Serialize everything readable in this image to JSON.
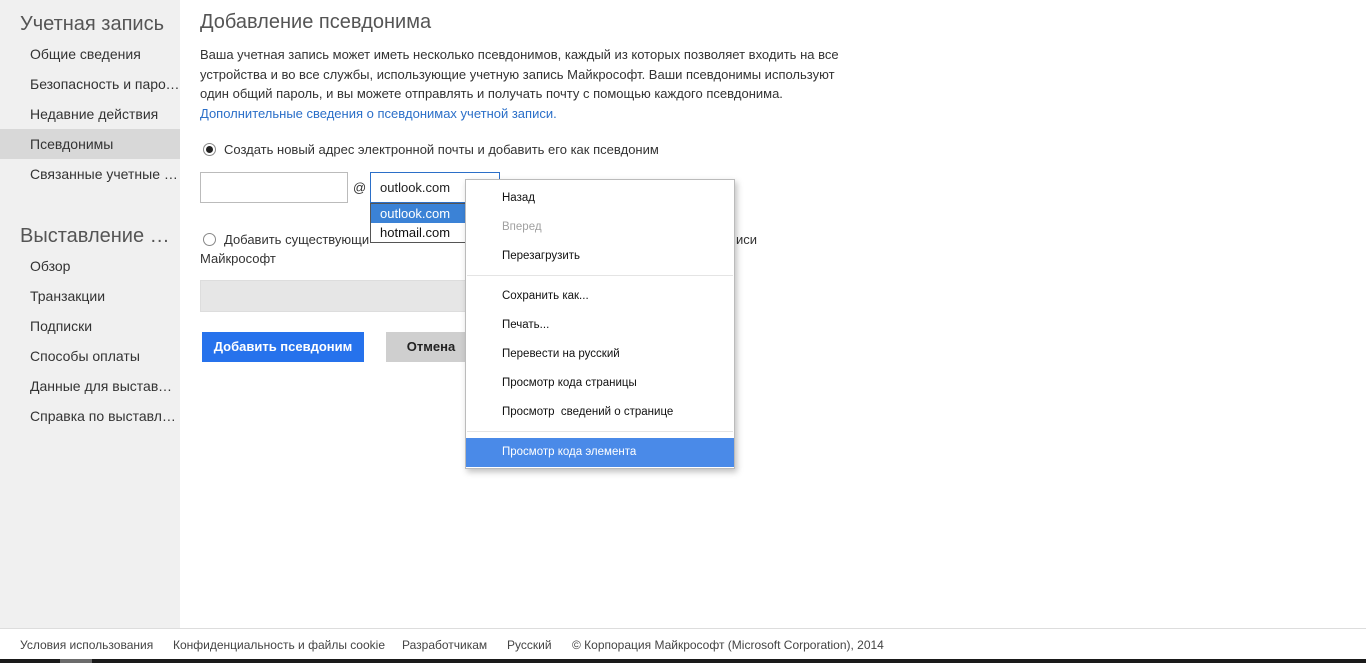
{
  "sidebar": {
    "header1": "Учетная запись",
    "items1": [
      "Общие сведения",
      "Безопасность и пароль",
      "Недавние действия",
      "Псевдонимы",
      "Связанные учетные з..."
    ],
    "header2": "Выставление сч...",
    "items2": [
      "Обзор",
      "Транзакции",
      "Подписки",
      "Способы оплаты",
      "Данные для выставле...",
      "Справка по выставле..."
    ]
  },
  "main": {
    "title": "Добавление псевдонима",
    "description": "Ваша учетная запись может иметь несколько псевдонимов, каждый из которых позволяет входить на все устройства и во все службы, использующие учетную запись Майкрософт. Ваши псевдонимы используют один общий пароль, и вы можете отправлять и получать почту с помощью каждого псевдонима.",
    "description_link": "Дополнительные сведения о псевдонимах учетной записи.",
    "option1_label": "Создать новый адрес электронной почты и добавить его как псевдоним",
    "at_sign": "@",
    "domain_selected": "outlook.com",
    "domain_options": [
      "outlook.com",
      "hotmail.com"
    ],
    "option2_label_start": "Добавить существующи",
    "option2_label_end": "иси",
    "option2_label_line2": "Майкрософт",
    "add_button": "Добавить псевдоним",
    "cancel_button": "Отмена"
  },
  "context_menu": {
    "back": "Назад",
    "forward": "Вперед",
    "reload": "Перезагрузить",
    "save_as": "Сохранить как...",
    "print": "Печать...",
    "translate": "Перевести на русский",
    "view_source": "Просмотр кода страницы",
    "page_info": "Просмотр  сведений о странице",
    "inspect": "Просмотр кода элемента"
  },
  "footer": {
    "terms": "Условия использования",
    "privacy": "Конфиденциальность и файлы cookie",
    "developers": "Разработчикам",
    "language": "Русский",
    "copyright": "© Корпорация Майкрософт (Microsoft Corporation), 2014"
  },
  "colors": {
    "accent": "#2672ec",
    "link": "#2b6fc8",
    "menu_highlight": "#4a8ae8"
  }
}
